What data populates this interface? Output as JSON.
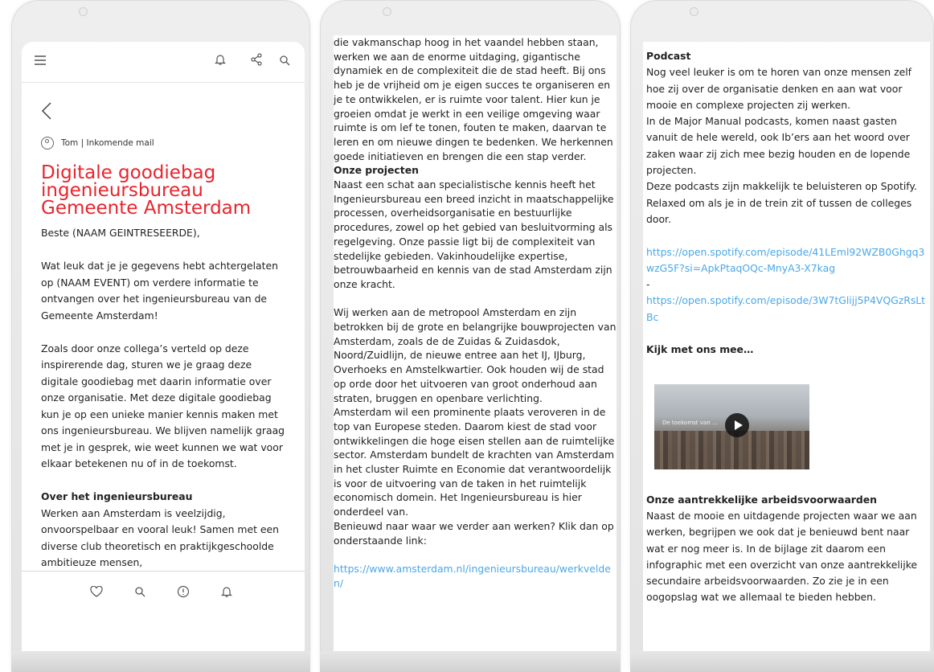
{
  "phone1": {
    "topbar": {
      "menu_icon": "hamburger-icon",
      "bell_icon": "bell-icon",
      "share_icon": "share-icon",
      "search_icon": "search-icon"
    },
    "back_icon": "chevron-left-icon",
    "sender": "Tom | Inkomende mail",
    "subject": "Digitale goodiebag ingenieursbureau Gemeente Amsterdam",
    "paragraphs": [
      "Beste (NAAM GEINTRESEERDE),",
      "Wat leuk dat je je gegevens hebt achtergelaten op (NAAM EVENT) om verdere informatie te ontvangen over het ingenieursbureau van de Gemeente Amsterdam!",
      "Zoals door onze collega’s verteld op deze inspirerende dag, sturen we je graag deze digitale goodiebag met daarin informatie over onze organisatie. Met deze digitale goodiebag kun je op een unieke manier kennis maken met ons ingenieursbureau. We blijven namelijk graag met je in gesprek, wie weet kunnen we wat voor elkaar betekenen nu of in de toekomst."
    ],
    "section_heading": "Over het ingenieursbureau",
    "section_text": "Werken aan Amsterdam is veelzijdig, onvoorspelbaar en vooral leuk! Samen met een diverse club theoretisch en praktijkgeschoolde ambitieuze mensen,",
    "bottombar": {
      "heart_icon": "heart-icon",
      "search_icon": "search-icon",
      "info_icon": "info-icon",
      "bell_icon": "bell-icon"
    }
  },
  "phone2": {
    "intro": "die vakmanschap hoog in het vaandel hebben staan, werken we aan de enorme uitdaging, gigantische dynamiek en de complexiteit die de stad heeft. Bij ons heb je de vrijheid om je eigen succes te organiseren en je te ontwikkelen, er is ruimte voor talent. Hier kun je groeien omdat je werkt in een veilige omgeving waar ruimte is om lef te tonen, fouten te maken, daarvan te leren en om nieuwe dingen te bedenken. We herkennen goede initiatieven en brengen die een stap verder.",
    "heading": "Onze projecten",
    "p1": "Naast een schat aan specialistische kennis heeft het Ingenieursbureau een breed inzicht in maatschappelijke processen, overheidsorganisatie en bestuurlijke procedures, zowel op het gebied van besluitvorming als regelgeving. Onze passie ligt bij de complexiteit van stedelijke gebieden. Vakinhoudelijke expertise, betrouwbaarheid en kennis van de stad Amsterdam zijn onze kracht.",
    "p2": "Wij werken aan de metropool Amsterdam en zijn betrokken bij de grote en belangrijke bouwprojecten van Amsterdam, zoals de de Zuidas & Zuidasdok, Noord/Zuidlijn, de nieuwe entree aan het IJ, IJburg, Overhoeks en Amstelkwartier. Ook houden wij de stad op orde door het uitvoeren van groot onderhoud aan straten, bruggen en openbare verlichting.",
    "p3": "Amsterdam wil een prominente plaats veroveren in de top van Europese steden. Daarom kiest de stad voor ontwikkelingen die hoge eisen stellen aan de ruimtelijke sector. Amsterdam bundelt de krachten van Amsterdam in het cluster Ruimte en Economie dat verantwoordelijk is voor de uitvoering van de taken in het ruimtelijk economisch domein. Het Ingenieursbureau is hier onderdeel van.",
    "p4": "Benieuwd naar waar we verder aan werken? Klik dan op onderstaande link:",
    "link": "https://www.amsterdam.nl/ingenieursbureau/werkvelden/"
  },
  "phone3": {
    "podcast_heading": "Podcast",
    "podcast_p1": "Nog veel leuker is om te horen van onze mensen zelf hoe zij over de organisatie denken en aan wat voor mooie en complexe projecten zij werken.",
    "podcast_p2": "In de Major Manual podcasts, komen naast gasten vanuit de hele wereld, ook Ib’ers aan het woord over zaken waar zij zich mee bezig houden en de lopende projecten.",
    "podcast_p3": "Deze podcasts zijn makkelijk te beluisteren op Spotify. Relaxed om als je in de trein zit of tussen de colleges door.",
    "link1": "https://open.spotify.com/episode/41LEml92WZB0Ghgq3wzG5F?si=ApkPtaqOQc-MnyA3-X7kag",
    "link_separator": "-",
    "link2": "https://open.spotify.com/episode/3W7tGlijj5P4VQGzRsLtBc",
    "video_heading": "Kijk met ons mee…",
    "video_caption": "De toekomst van …",
    "video_play_icon": "play-icon",
    "benefits_heading": "Onze aantrekkelijke arbeidsvoorwaarden",
    "benefits_text": "Naast de mooie en uitdagende projecten waar we aan werken, begrijpen we ook dat je benieuwd bent naar wat er nog meer is. In de bijlage zit daarom een infographic met een overzicht van onze aantrekkelijke secundaire arbeidsvoorwaarden. Zo zie je in een oogopslag wat we allemaal te bieden hebben."
  }
}
